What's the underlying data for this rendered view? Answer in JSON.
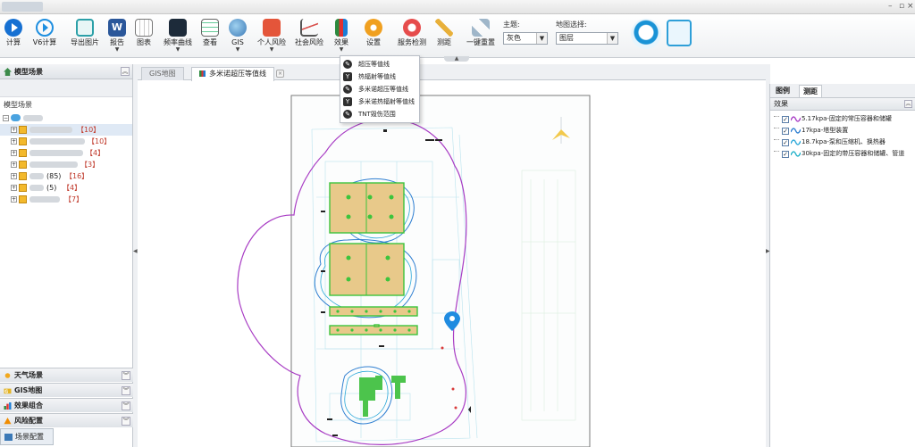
{
  "toolbar": {
    "buttons": [
      {
        "label": "计算"
      },
      {
        "label": "V6计算"
      },
      {
        "label": "导出图片"
      },
      {
        "label": "报告"
      },
      {
        "label": "图表"
      },
      {
        "label": "频率曲线"
      },
      {
        "label": "查看"
      },
      {
        "label": "GIS"
      },
      {
        "label": "个人风险"
      },
      {
        "label": "社会风险"
      },
      {
        "label": "效果"
      },
      {
        "label": "设置"
      },
      {
        "label": "服务检测"
      },
      {
        "label": "测距"
      },
      {
        "label": "一键重置"
      }
    ],
    "theme_label": "主题:",
    "theme_value": "灰色",
    "map_label": "地图选择:",
    "map_value": "图层"
  },
  "effect_menu": {
    "items": [
      {
        "label": "超压等值线"
      },
      {
        "label": "热辐射等值线"
      },
      {
        "label": "多米诺超压等值线"
      },
      {
        "label": "多米诺热辐射等值线"
      },
      {
        "label": "TNT毁伤范围"
      }
    ]
  },
  "left_panel": {
    "title": "模型场景",
    "scene_label": "模型场景",
    "tree": [
      {
        "count": "【10】"
      },
      {
        "count": "【10】"
      },
      {
        "count": "【4】"
      },
      {
        "count": "【3】"
      },
      {
        "label": "(85)",
        "count": "【16】"
      },
      {
        "label": "(5)",
        "count": "【4】"
      },
      {
        "count": "【7】"
      }
    ],
    "accordions": [
      {
        "label": "天气场景"
      },
      {
        "label": "GIS地图"
      },
      {
        "label": "效果组合"
      },
      {
        "label": "风险配置"
      }
    ],
    "bottom_tab": "场景配置"
  },
  "tabs": [
    {
      "label": "GIS地图"
    },
    {
      "label": "多米诺超压等值线"
    }
  ],
  "right_panel": {
    "tabs": [
      {
        "label": "图例"
      },
      {
        "label": "测距"
      }
    ],
    "section": "效果",
    "legend": [
      {
        "label": "5.17kpa-固定的常压容器和储罐",
        "color": "#a83cc4"
      },
      {
        "label": "17kpa-塔型装置",
        "color": "#2f7fd1"
      },
      {
        "label": "18.7kpa-泵和压缩机、换热器",
        "color": "#2aa7d8"
      },
      {
        "label": "30kpa-固定的带压容器和储罐、管道",
        "color": "#1fb0c8"
      }
    ]
  },
  "colors": {
    "accent": "#1670d2",
    "contour_outer": "#a83cc4",
    "contour_inner": "#2f7fd1",
    "tank_fill": "#e8c98a",
    "tank_outline": "#3cc43c"
  }
}
